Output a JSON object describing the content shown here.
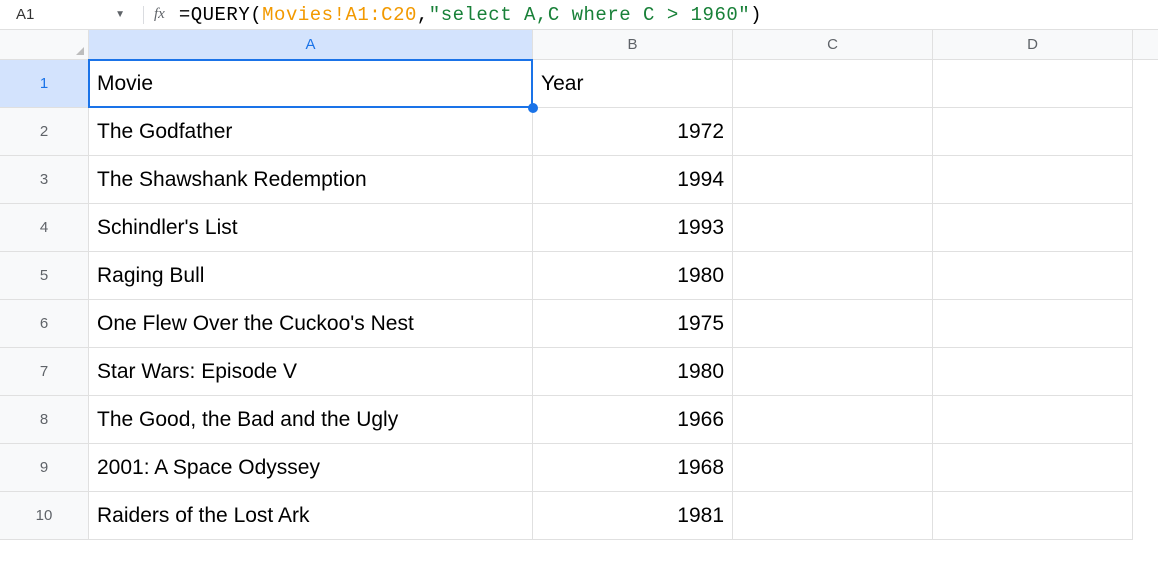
{
  "name_box": {
    "value": "A1"
  },
  "formula_bar": {
    "fx_label": "fx",
    "prefix": "=QUERY(",
    "range": "Movies!A1:C20",
    "comma": ", ",
    "query_string": "\"select A,C where C > 1960\"",
    "suffix": ")"
  },
  "columns": [
    "A",
    "B",
    "C",
    "D"
  ],
  "selected_column": "A",
  "selected_row": 1,
  "rows": [
    {
      "num": 1,
      "a": "Movie",
      "b": "Year",
      "b_is_text": true
    },
    {
      "num": 2,
      "a": "The Godfather",
      "b": "1972"
    },
    {
      "num": 3,
      "a": "The Shawshank Redemption",
      "b": "1994"
    },
    {
      "num": 4,
      "a": "Schindler's List",
      "b": "1993"
    },
    {
      "num": 5,
      "a": "Raging Bull",
      "b": "1980"
    },
    {
      "num": 6,
      "a": "One Flew Over the Cuckoo's Nest",
      "b": "1975"
    },
    {
      "num": 7,
      "a": "Star Wars: Episode V",
      "b": "1980"
    },
    {
      "num": 8,
      "a": "The Good, the Bad and the Ugly",
      "b": "1966"
    },
    {
      "num": 9,
      "a": "2001: A Space Odyssey",
      "b": "1968"
    },
    {
      "num": 10,
      "a": "Raiders of the Lost Ark",
      "b": "1981"
    }
  ]
}
